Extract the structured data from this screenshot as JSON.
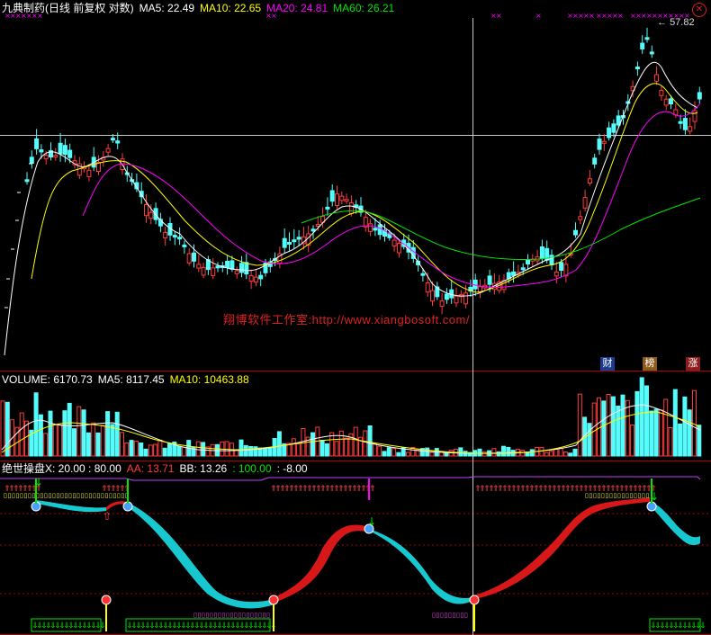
{
  "main_header": {
    "title": "九典制药(日线 前复权 对数)",
    "ma5": "MA5: 22.49",
    "ma10": "MA10: 22.65",
    "ma20": "MA20: 24.81",
    "ma60": "MA60: 26.21"
  },
  "max_price_label": "57.82",
  "watermark": "翔博软件工作室:http://www.xiangbosoft.com/",
  "badges": {
    "cai": "财",
    "bang": "榜",
    "zhang": "涨"
  },
  "volume_header": {
    "volume": "VOLUME: 6170.73",
    "ma5": "MA5: 8117.45",
    "ma10": "MA10: 10463.88"
  },
  "indicator_header": {
    "name": "绝世操盘X",
    "params": ": 20.00 : 80.00",
    "aa": "AA: 13.71",
    "bb": "BB: 13.26",
    "v100": ": 100.00",
    "v8": ": -8.00"
  },
  "close_icon": "close-icon",
  "colors": {
    "up": "#ff3c3c",
    "down": "#54fcfc",
    "ma5": "#ffffff",
    "ma10": "#ffff00",
    "ma20": "#ff00ff",
    "ma60": "#00e600",
    "panel_border": "#b00000"
  }
}
